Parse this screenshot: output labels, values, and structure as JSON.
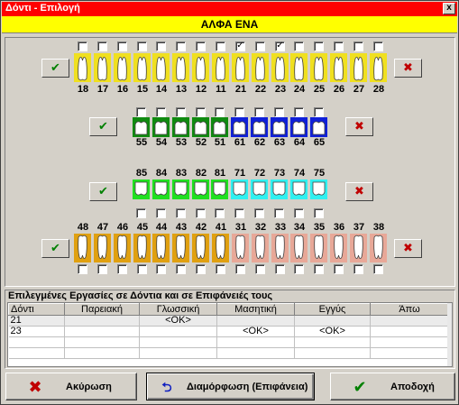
{
  "window": {
    "title": "Δόντι - Επιλογή",
    "close": "x"
  },
  "patient": {
    "name": "ΑΛΦΑ ΕΝΑ"
  },
  "colors": {
    "yellow": "#f0e020",
    "green": "#108a10",
    "lightgreen": "#20e020",
    "blue": "#1020d8",
    "cyan": "#30f0f0",
    "orange": "#e0a010",
    "pink": "#e8a898"
  },
  "rows": [
    {
      "key": "upper_perm",
      "numbers": [
        "18",
        "17",
        "16",
        "15",
        "14",
        "13",
        "12",
        "11",
        "21",
        "22",
        "23",
        "24",
        "25",
        "26",
        "27",
        "28"
      ],
      "checked": [
        false,
        false,
        false,
        false,
        false,
        false,
        false,
        false,
        true,
        false,
        true,
        false,
        false,
        false,
        false,
        false
      ],
      "colors": [
        "yellow",
        "yellow",
        "yellow",
        "yellow",
        "yellow",
        "yellow",
        "yellow",
        "yellow",
        "yellow",
        "yellow",
        "yellow",
        "yellow",
        "yellow",
        "yellow",
        "yellow",
        "yellow"
      ]
    },
    {
      "key": "upper_deci",
      "numbers": [
        "55",
        "54",
        "53",
        "52",
        "51",
        "61",
        "62",
        "63",
        "64",
        "65"
      ],
      "checked": [
        false,
        false,
        false,
        false,
        false,
        false,
        false,
        false,
        false,
        false
      ],
      "colors": [
        "green",
        "green",
        "green",
        "green",
        "green",
        "blue",
        "blue",
        "blue",
        "blue",
        "blue"
      ]
    },
    {
      "key": "lower_deci",
      "numbers": [
        "85",
        "84",
        "83",
        "82",
        "81",
        "71",
        "72",
        "73",
        "74",
        "75"
      ],
      "checked": [
        false,
        false,
        false,
        false,
        false,
        false,
        false,
        false,
        false,
        false
      ],
      "colors": [
        "lightgreen",
        "lightgreen",
        "lightgreen",
        "lightgreen",
        "lightgreen",
        "cyan",
        "cyan",
        "cyan",
        "cyan",
        "cyan"
      ]
    },
    {
      "key": "lower_perm",
      "numbers": [
        "48",
        "47",
        "46",
        "45",
        "44",
        "43",
        "42",
        "41",
        "31",
        "32",
        "33",
        "34",
        "35",
        "36",
        "37",
        "38"
      ],
      "checked": [
        false,
        false,
        false,
        false,
        false,
        false,
        false,
        false,
        false,
        false,
        false,
        false,
        false,
        false,
        false,
        false
      ],
      "colors": [
        "orange",
        "orange",
        "orange",
        "orange",
        "orange",
        "orange",
        "orange",
        "orange",
        "pink",
        "pink",
        "pink",
        "pink",
        "pink",
        "pink",
        "pink",
        "pink"
      ]
    }
  ],
  "row_buttons": {
    "ok": "✔",
    "cancel": "✖"
  },
  "checkmark": "✓",
  "works": {
    "title": "Επιλεγμένες Εργασίες σε Δόντια και σε Επιφάνειές τους",
    "columns": [
      "Δόντι",
      "Παρειακή",
      "Γλωσσική",
      "Μασητική",
      "Εγγύς",
      "Άπω"
    ],
    "rows": [
      [
        "21",
        "",
        "<OK>",
        "",
        "",
        ""
      ],
      [
        "23",
        "",
        "",
        "<OK>",
        "<OK>",
        ""
      ],
      [
        "",
        "",
        "",
        "",
        "",
        ""
      ],
      [
        "",
        "",
        "",
        "",
        "",
        ""
      ]
    ]
  },
  "buttons": {
    "cancel": "Ακύρωση",
    "configure": "Διαμόρφωση (Επιφάνεια)",
    "accept": "Αποδοχή"
  }
}
